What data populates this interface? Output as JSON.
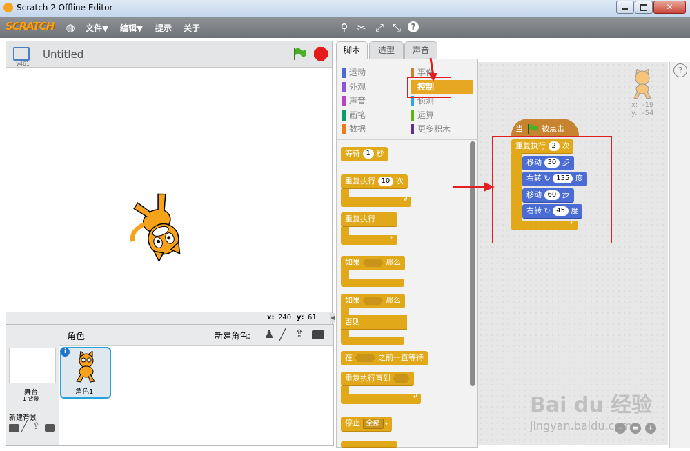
{
  "window": {
    "title": "Scratch 2 Offline Editor"
  },
  "menubar": {
    "logo": "SCRATCH",
    "file": "文件▼",
    "edit": "编辑▼",
    "tips": "提示",
    "about": "关于"
  },
  "stage": {
    "name": "Untitled",
    "version": "v461",
    "mouse_x_label": "x:",
    "mouse_x": "240",
    "mouse_y_label": "y:",
    "mouse_y": "61"
  },
  "sprites": {
    "header": "角色",
    "new_sprite_label": "新建角色:",
    "stage_label": "舞台",
    "backdrop_count": "1 背景",
    "new_backdrop": "新建背景",
    "sprite1_name": "角色1"
  },
  "tabs": [
    {
      "label": "脚本",
      "active": true
    },
    {
      "label": "造型",
      "active": false
    },
    {
      "label": "声音",
      "active": false
    }
  ],
  "categories": [
    {
      "label": "运动",
      "color": "#4a6cd4"
    },
    {
      "label": "外观",
      "color": "#8a55d7"
    },
    {
      "label": "声音",
      "color": "#bb42c3"
    },
    {
      "label": "画笔",
      "color": "#0e9a6c"
    },
    {
      "label": "数据",
      "color": "#ee7d16"
    },
    {
      "label": "事件",
      "color": "#c88330"
    },
    {
      "label": "控制",
      "color": "#e1a91a",
      "selected": true
    },
    {
      "label": "侦测",
      "color": "#2ca5e2"
    },
    {
      "label": "运算",
      "color": "#5cb712"
    },
    {
      "label": "更多积木",
      "color": "#632d99"
    }
  ],
  "palette": {
    "wait": {
      "label": "等待",
      "value": "1",
      "unit": "秒"
    },
    "repeat": {
      "label": "重复执行",
      "value": "10",
      "unit": "次"
    },
    "forever": {
      "label": "重复执行"
    },
    "if_then": {
      "label": "如果",
      "then": "那么"
    },
    "if_else": {
      "label": "如果",
      "then": "那么",
      "else": "否则"
    },
    "wait_until": {
      "label": "在",
      "suffix": "之前一直等待"
    },
    "repeat_until": {
      "label": "重复执行直到"
    },
    "stop": {
      "label": "停止",
      "option": "全部"
    }
  },
  "script": {
    "hat": {
      "label": "当",
      "suffix": "被点击"
    },
    "repeat": {
      "label": "重复执行",
      "value": "2",
      "unit": "次"
    },
    "move1": {
      "label": "移动",
      "value": "30",
      "unit": "步"
    },
    "turn1": {
      "label": "右转",
      "value": "135",
      "unit": "度"
    },
    "move2": {
      "label": "移动",
      "value": "60",
      "unit": "步"
    },
    "turn2": {
      "label": "右转",
      "value": "45",
      "unit": "度"
    }
  },
  "sprite_info": {
    "x_label": "x:",
    "x": "-19",
    "y_label": "y:",
    "y": "-54"
  },
  "watermark": {
    "brand": "Bai du 经验",
    "url": "jingyan.baidu.com"
  },
  "colors": {
    "control": "#e1a91a",
    "motion": "#4a6cd4",
    "events": "#c88330",
    "annotation": "#e02020"
  }
}
